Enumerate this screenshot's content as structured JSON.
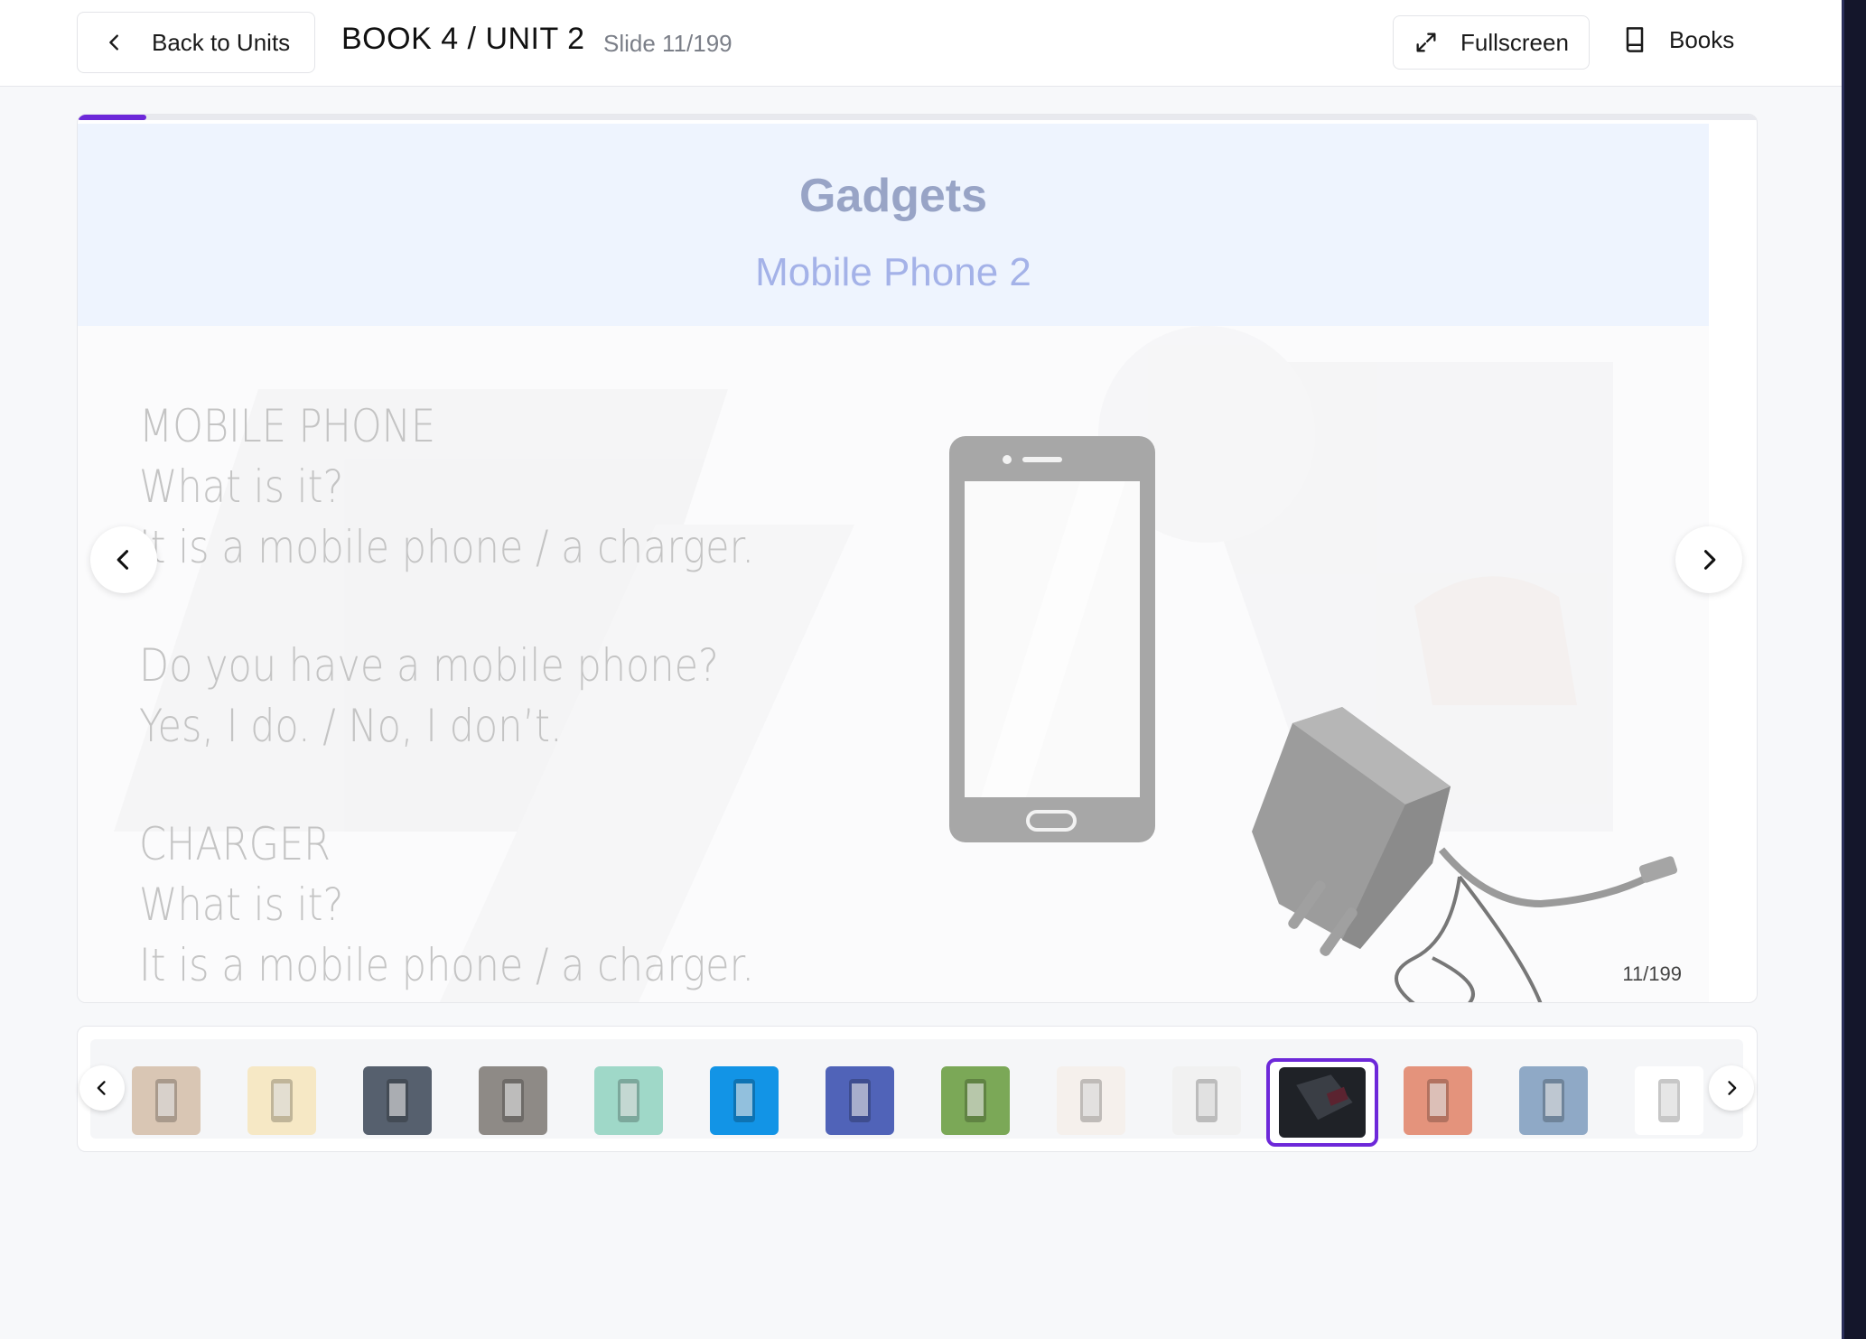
{
  "header": {
    "back_label": "Back to Units",
    "title": "BOOK 4 / UNIT 2",
    "slide_counter": "Slide 11/199",
    "fullscreen_label": "Fullscreen",
    "books_label": "Books"
  },
  "slide": {
    "progress_fraction": 0.041,
    "title": "Gadgets",
    "subtitle": "Mobile Phone 2",
    "lines": [
      "MOBILE PHONE",
      "What is it?",
      "It is a mobile phone / a charger.",
      "",
      "Do you have a mobile phone?",
      "Yes, I do. / No, I don’t.",
      "",
      "CHARGER",
      "What is it?",
      "It is a mobile phone / a charger."
    ],
    "page_indicator": "11/199"
  },
  "thumbnails": {
    "count_visible": 14,
    "active_index": 10,
    "items": [
      {
        "name": "thumb-gadgets-cover",
        "color": "#d9c6b4"
      },
      {
        "name": "thumb-yellow-phone",
        "color": "#f6e8c5"
      },
      {
        "name": "thumb-slate-phone",
        "color": "#56606e"
      },
      {
        "name": "thumb-phone-pebbles",
        "color": "#8e8a86"
      },
      {
        "name": "thumb-pattern-phones",
        "color": "#9fd8c8"
      },
      {
        "name": "thumb-banana-blue",
        "color": "#1294e6"
      },
      {
        "name": "thumb-hand-phone-apps",
        "color": "#5063b8"
      },
      {
        "name": "thumb-game-scene",
        "color": "#7ba857"
      },
      {
        "name": "thumb-hands-wifi",
        "color": "#f5f0ec"
      },
      {
        "name": "thumb-phone-sketch",
        "color": "#f1f1f1"
      },
      {
        "name": "thumb-dark-phone-charger",
        "color": "#1f2227"
      },
      {
        "name": "thumb-selfie",
        "color": "#e4937c"
      },
      {
        "name": "thumb-charger-cable",
        "color": "#8fa9c6"
      },
      {
        "name": "thumb-video-phone",
        "color": "#ffffff"
      }
    ]
  },
  "colors": {
    "accent": "#6d28d9",
    "slide_header_bg": "#eef4fe",
    "slide_title": "#98a4c6",
    "slide_subtitle": "#a4b2e8"
  }
}
